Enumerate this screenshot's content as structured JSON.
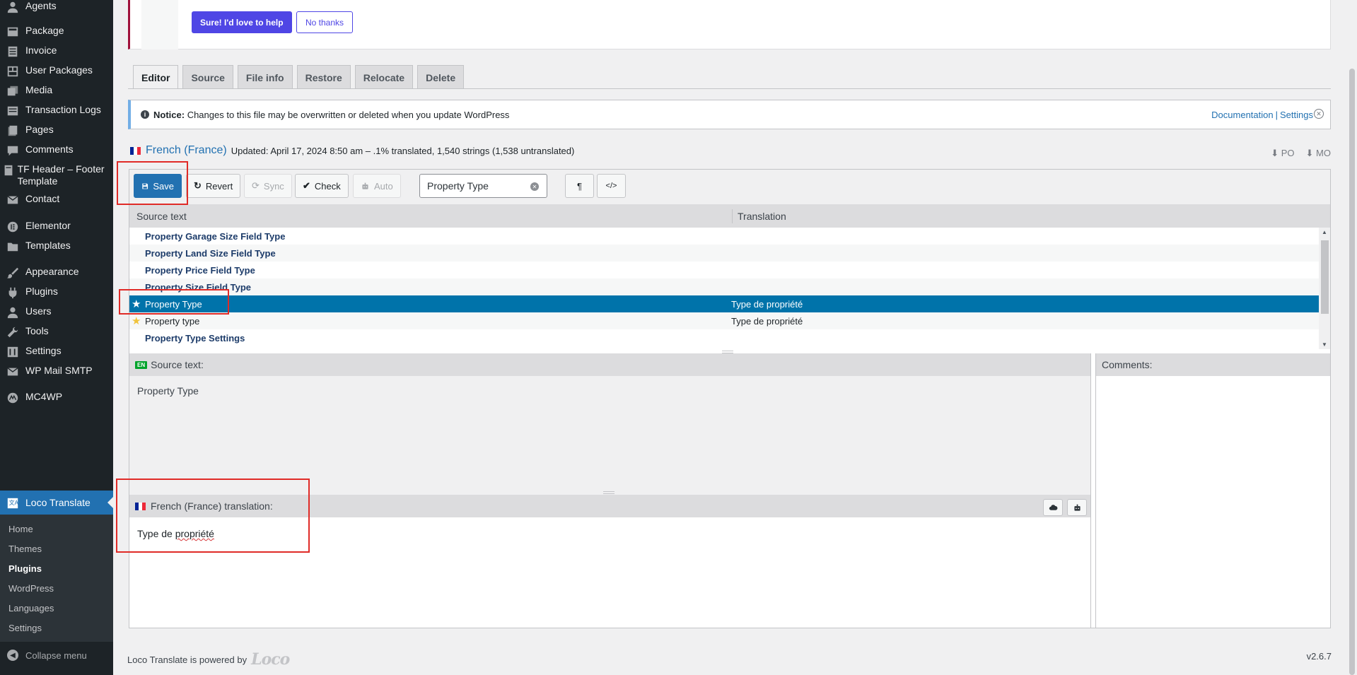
{
  "sidebar": {
    "items": [
      {
        "label": "Agents",
        "icon": "user-icon"
      },
      {
        "label": "Package",
        "icon": "package-icon"
      },
      {
        "label": "Invoice",
        "icon": "invoice-icon"
      },
      {
        "label": "User Packages",
        "icon": "gallery-icon"
      },
      {
        "label": "Media",
        "icon": "media-icon"
      },
      {
        "label": "Transaction Logs",
        "icon": "list-icon"
      },
      {
        "label": "Pages",
        "icon": "pages-icon"
      },
      {
        "label": "Comments",
        "icon": "comments-icon"
      },
      {
        "label": "TF Header – Footer Template",
        "icon": "template-icon"
      },
      {
        "label": "Contact",
        "icon": "mail-icon"
      },
      {
        "label": "Elementor",
        "icon": "elementor-icon"
      },
      {
        "label": "Templates",
        "icon": "folder-icon"
      },
      {
        "label": "Appearance",
        "icon": "brush-icon"
      },
      {
        "label": "Plugins",
        "icon": "plugin-icon"
      },
      {
        "label": "Users",
        "icon": "users-icon"
      },
      {
        "label": "Tools",
        "icon": "wrench-icon"
      },
      {
        "label": "Settings",
        "icon": "settings-icon"
      },
      {
        "label": "WP Mail SMTP",
        "icon": "mail-smtp-icon"
      },
      {
        "label": "MC4WP",
        "icon": "mc4wp-icon"
      },
      {
        "label": "Loco Translate",
        "icon": "translate-icon"
      }
    ],
    "submenu": [
      "Home",
      "Themes",
      "Plugins",
      "WordPress",
      "Languages",
      "Settings"
    ],
    "submenu_current": "Plugins",
    "collapse_label": "Collapse menu"
  },
  "top_notice": {
    "primary_label": "Sure! I'd love to help",
    "secondary_label": "No thanks"
  },
  "tabs": [
    {
      "label": "Editor",
      "active": true
    },
    {
      "label": "Source"
    },
    {
      "label": "File info"
    },
    {
      "label": "Restore"
    },
    {
      "label": "Relocate"
    },
    {
      "label": "Delete"
    }
  ],
  "notice": {
    "bold": "Notice:",
    "text": "Changes to this file may be overwritten or deleted when you update WordPress",
    "link1": "Documentation",
    "sep": "|",
    "link2": "Settings"
  },
  "header": {
    "language": "French (France)",
    "updated": "Updated: April 17, 2024 8:50 am – .1% translated, 1,540 strings (1,538 untranslated)",
    "download_po": "PO",
    "download_mo": "MO"
  },
  "toolbar": {
    "save": "Save",
    "revert": "Revert",
    "sync": "Sync",
    "check": "Check",
    "auto": "Auto",
    "search_value": "Property Type",
    "pilcrow": "¶",
    "code": "</>"
  },
  "columns": {
    "source": "Source text",
    "translation": "Translation"
  },
  "rows": [
    {
      "source": "Property Garage Size Field Type",
      "translation": "",
      "bold": true
    },
    {
      "source": "Property Land Size Field Type",
      "translation": "",
      "bold": true
    },
    {
      "source": "Property Price Field Type",
      "translation": "",
      "bold": true
    },
    {
      "source": "Property Size Field Type",
      "translation": "",
      "bold": true
    },
    {
      "source": "Property Type",
      "translation": "Type de propriété",
      "selected": true,
      "star": true
    },
    {
      "source": "Property type",
      "translation": "Type de propriété",
      "star": true
    },
    {
      "source": "Property Type Settings",
      "translation": "",
      "bold": true
    }
  ],
  "source_panel": {
    "badge": "EN",
    "label": "Source text:",
    "text": "Property Type"
  },
  "comments_panel": {
    "label": "Comments:"
  },
  "translation_panel": {
    "label": "French (France) translation:",
    "text_plain": "Type de ",
    "text_marked": "propriété"
  },
  "footer": {
    "powered": "Loco Translate is powered by",
    "logo": "Loco",
    "version": "v2.6.7"
  },
  "colors": {
    "sidebar_bg": "#1d2327",
    "accent": "#2271b1",
    "selected_row": "#0073aa",
    "highlight_box": "#e02b27",
    "purple": "#4f46e5"
  }
}
